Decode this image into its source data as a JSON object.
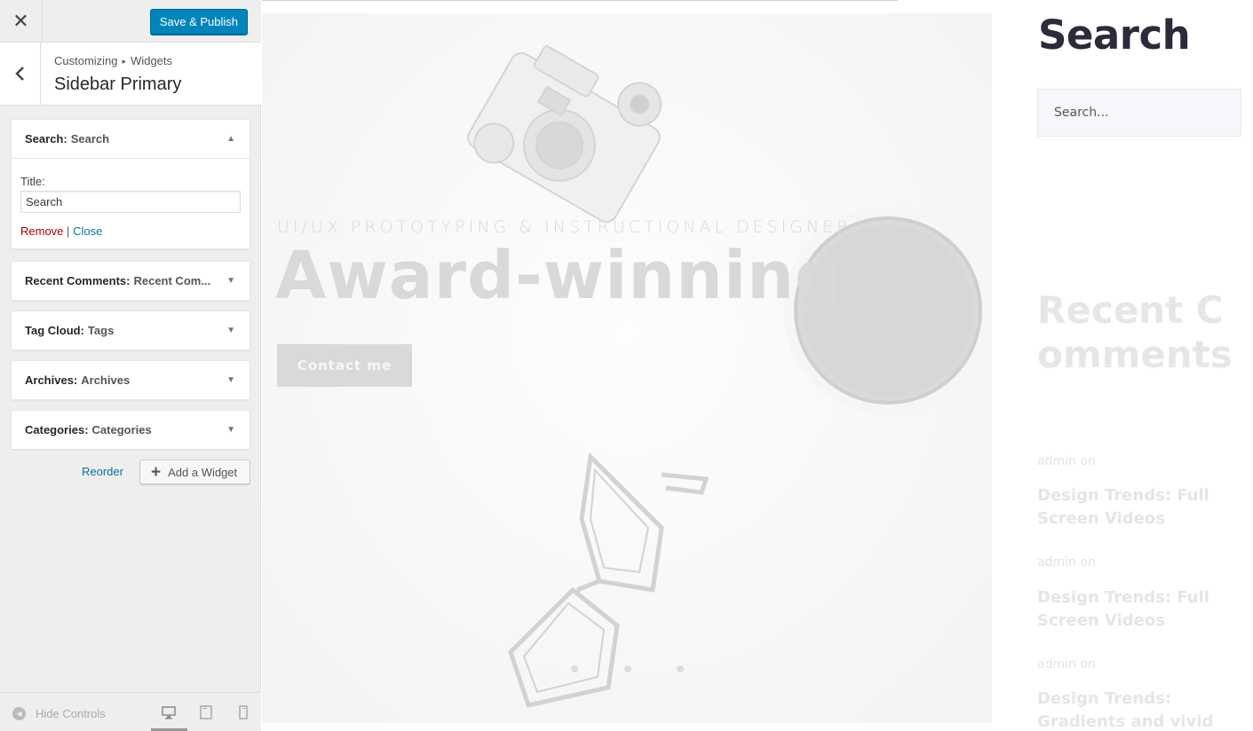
{
  "topbar": {
    "close_icon": "close-icon",
    "save_label": "Save & Publish",
    "save_color": "#0085ba"
  },
  "section": {
    "breadcrumb_root": "Customizing",
    "breadcrumb_leaf": "Widgets",
    "title": "Sidebar Primary"
  },
  "widgets": [
    {
      "type": "Search:",
      "title": "Search",
      "expanded": true
    },
    {
      "type": "Recent Comments:",
      "title": "Recent Com..."
    },
    {
      "type": "Tag Cloud:",
      "title": "Tags"
    },
    {
      "type": "Archives:",
      "title": "Archives"
    },
    {
      "type": "Categories:",
      "title": "Categories"
    }
  ],
  "search_widget_form": {
    "title_label": "Title:",
    "title_value": "Search",
    "remove_label": "Remove",
    "separator": "|",
    "close_label": "Close"
  },
  "actions": {
    "reorder_label": "Reorder",
    "add_widget_label": "Add a Widget"
  },
  "footer": {
    "hide_controls_label": "Hide Controls",
    "active_device": "desktop"
  },
  "preview": {
    "hero_subtitle": "UI/UX PROTOTYPING & INSTRUCTIONAL DESIGNER",
    "hero_title": "Award-winning",
    "hero_button": "Contact me",
    "sidebar_search_title": "Search",
    "sidebar_search_placeholder": "Search...",
    "recent_comments_title": "Recent Comments",
    "comments": [
      {
        "author": "admin on",
        "post": "Design Trends: Full Screen Videos"
      },
      {
        "author": "admin on",
        "post": "Design Trends: Full Screen Videos"
      },
      {
        "author": "admin on",
        "post": "Design Trends: Gradients and vivid colours"
      }
    ]
  }
}
